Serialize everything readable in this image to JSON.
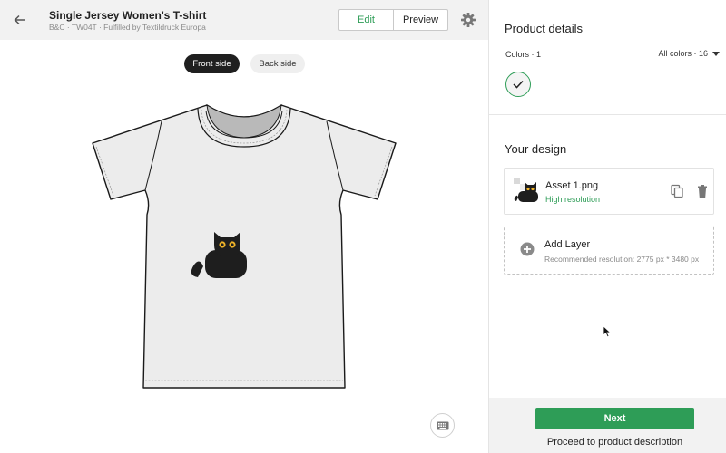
{
  "header": {
    "back_icon": "arrow-left-icon",
    "title": "Single Jersey Women's T-shirt",
    "subtitle": "B&C · TW04T · Fulfilled by Textildruck Europa",
    "edit_label": "Edit",
    "preview_label": "Preview",
    "settings_icon": "gear-icon"
  },
  "canvas": {
    "front_label": "Front side",
    "back_label": "Back side",
    "selected_side": "Front side",
    "keyboard_icon": "keyboard-icon"
  },
  "product_details": {
    "title": "Product details",
    "colors_label": "Colors · 1",
    "all_colors_label": "All colors · 16",
    "selected_swatch_color": "#f4f4f4"
  },
  "design": {
    "title": "Your design",
    "asset": {
      "name": "Asset 1.png",
      "status": "High resolution",
      "copy_icon": "copy-icon",
      "delete_icon": "trash-icon"
    },
    "add_layer": {
      "title": "Add Layer",
      "hint": "Recommended resolution: 2775 px * 3480 px",
      "icon": "add-circle-icon"
    }
  },
  "footer": {
    "next_label": "Next",
    "proceed_label": "Proceed to product description"
  },
  "colors": {
    "accent": "#2e9d57",
    "panel_bg": "#f2f2f2",
    "pill_dark": "#1f1f1f"
  }
}
